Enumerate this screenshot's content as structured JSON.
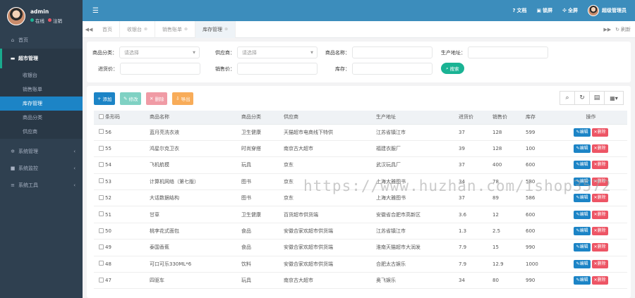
{
  "sidebar": {
    "user_name": "admin",
    "status_online": "在线",
    "status_logout": "注销",
    "home": "首页",
    "supermarket": "超市管理",
    "sub_items": [
      "收银台",
      "销售账单",
      "库存管理",
      "商品分类",
      "供应商"
    ],
    "system_mgmt": "系统管理",
    "system_monitor": "系统监控",
    "system_tools": "系统工具"
  },
  "topbar": {
    "docs": "文档",
    "lock": "锁屏",
    "fullscreen": "全屏",
    "user": "超级管理员"
  },
  "tabs": {
    "items": [
      "首页",
      "收银台",
      "销售账单",
      "库存管理"
    ],
    "refresh": "刷新"
  },
  "search": {
    "category_label": "商品分类：",
    "category_placeholder": "请选择",
    "supplier_label": "供应商：",
    "supplier_placeholder": "请选择",
    "name_label": "商品名称：",
    "origin_label": "生产地址：",
    "purchase_label": "进货价：",
    "sale_label": "销售价：",
    "stock_label": "库存：",
    "search_btn": "搜索"
  },
  "toolbar": {
    "add": "添加",
    "edit": "修改",
    "delete": "删除",
    "export": "导出"
  },
  "table": {
    "headers": [
      "条形码",
      "商品名称",
      "商品分类",
      "供应商",
      "生产地址",
      "进货价",
      "销售价",
      "库存",
      "操作"
    ],
    "edit_label": "编辑",
    "delete_label": "删除",
    "rows": [
      [
        "56",
        "蓝月亮洗衣液",
        "卫生健康",
        "天猫超市电商线下特供",
        "江苏省镇江市",
        "37",
        "128",
        "599"
      ],
      [
        "55",
        "鸿星尔克卫衣",
        "时尚穿搭",
        "南京古大超市",
        "福建衣服厂",
        "39",
        "128",
        "100"
      ],
      [
        "54",
        "飞机航模",
        "玩具",
        "京东",
        "武汉玩具厂",
        "37",
        "400",
        "600"
      ],
      [
        "53",
        "计算机网络（第七版）",
        "图书",
        "京东",
        "上海大雅图书",
        "34",
        "78",
        "580"
      ],
      [
        "52",
        "大话数据结构",
        "图书",
        "京东",
        "上海大雅图书",
        "37",
        "89",
        "586"
      ],
      [
        "51",
        "甘草",
        "卫生健康",
        "百货超市供货端",
        "安徽省合肥市高新区",
        "3.6",
        "12",
        "600"
      ],
      [
        "50",
        "桃李花式面包",
        "食品",
        "安徽合家欢超市供货端",
        "江苏省镇江市",
        "1.3",
        "2.5",
        "600"
      ],
      [
        "49",
        "泰国香蕉",
        "食品",
        "安徽合家欢超市供货端",
        "淮南天猫超市大润发",
        "7.9",
        "15",
        "990"
      ],
      [
        "48",
        "可口可乐330ML*6",
        "饮料",
        "安徽合家欢超市供货端",
        "合肥太古娱乐",
        "7.9",
        "12.9",
        "1000"
      ],
      [
        "47",
        "四驱车",
        "玩具",
        "南京古大超市",
        "奥飞娱乐",
        "34",
        "80",
        "990"
      ]
    ]
  },
  "watermark": "https://www.huzhan.com/ishop3572"
}
